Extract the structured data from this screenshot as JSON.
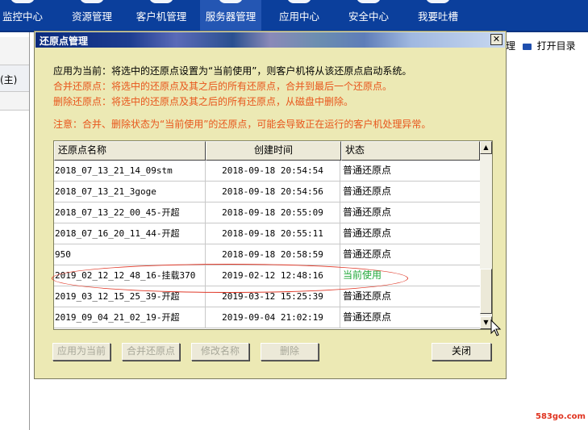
{
  "nav": {
    "items": [
      {
        "label": "监控中心"
      },
      {
        "label": "资源管理"
      },
      {
        "label": "客户机管理"
      },
      {
        "label": "服务器管理"
      },
      {
        "label": "应用中心"
      },
      {
        "label": "安全中心"
      },
      {
        "label": "我要吐槽"
      }
    ],
    "active_index": 3
  },
  "background": {
    "left_label": "(主)",
    "toolbar_fragment": "理",
    "open_dir_label": "打开目录"
  },
  "watermark": "583go.com",
  "dialog": {
    "title": "还原点管理",
    "close_glyph": "✕",
    "desc_apply": "应用为当前：将选中的还原点设置为“当前使用”，则客户机将从该还原点启动系统。",
    "desc_merge": "合并还原点：将选中的还原点及其之后的所有还原点，合并到最后一个还原点。",
    "desc_delete": "删除还原点：将选中的还原点及其之后的所有还原点，从磁盘中删除。",
    "desc_note": "注意：合并、删除状态为“当前使用”的还原点，可能会导致正在运行的客户机处理异常。",
    "columns": {
      "name": "还原点名称",
      "time": "创建时间",
      "status": "状态"
    },
    "rows": [
      {
        "name": "2018_07_13_21_14_09stm",
        "time": "2018-09-18 20:54:54",
        "status": "普通还原点",
        "current": false
      },
      {
        "name": "2018_07_13_21_3goge",
        "time": "2018-09-18 20:54:56",
        "status": "普通还原点",
        "current": false
      },
      {
        "name": "2018_07_13_22_00_45-开超",
        "time": "2018-09-18 20:55:09",
        "status": "普通还原点",
        "current": false
      },
      {
        "name": "2018_07_16_20_11_44-开超",
        "time": "2018-09-18 20:55:11",
        "status": "普通还原点",
        "current": false
      },
      {
        "name": "950",
        "time": "2018-09-18 20:58:59",
        "status": "普通还原点",
        "current": false
      },
      {
        "name": "2019_02_12_12_48_16-挂载370",
        "time": "2019-02-12 12:48:16",
        "status": "当前使用",
        "current": true
      },
      {
        "name": "2019_03_12_15_25_39-开超",
        "time": "2019-03-12 15:25:39",
        "status": "普通还原点",
        "current": false
      },
      {
        "name": "2019_09_04_21_02_19-开超",
        "time": "2019-09-04 21:02:19",
        "status": "普通还原点",
        "current": false
      }
    ],
    "buttons": {
      "apply": "应用为当前",
      "merge": "合并还原点",
      "rename": "修改名称",
      "delete": "删除",
      "close": "关闭"
    },
    "colors": {
      "current_status": "#22a83a",
      "warning_text": "#e8561c",
      "highlight_ellipse": "#e03a2a"
    }
  }
}
